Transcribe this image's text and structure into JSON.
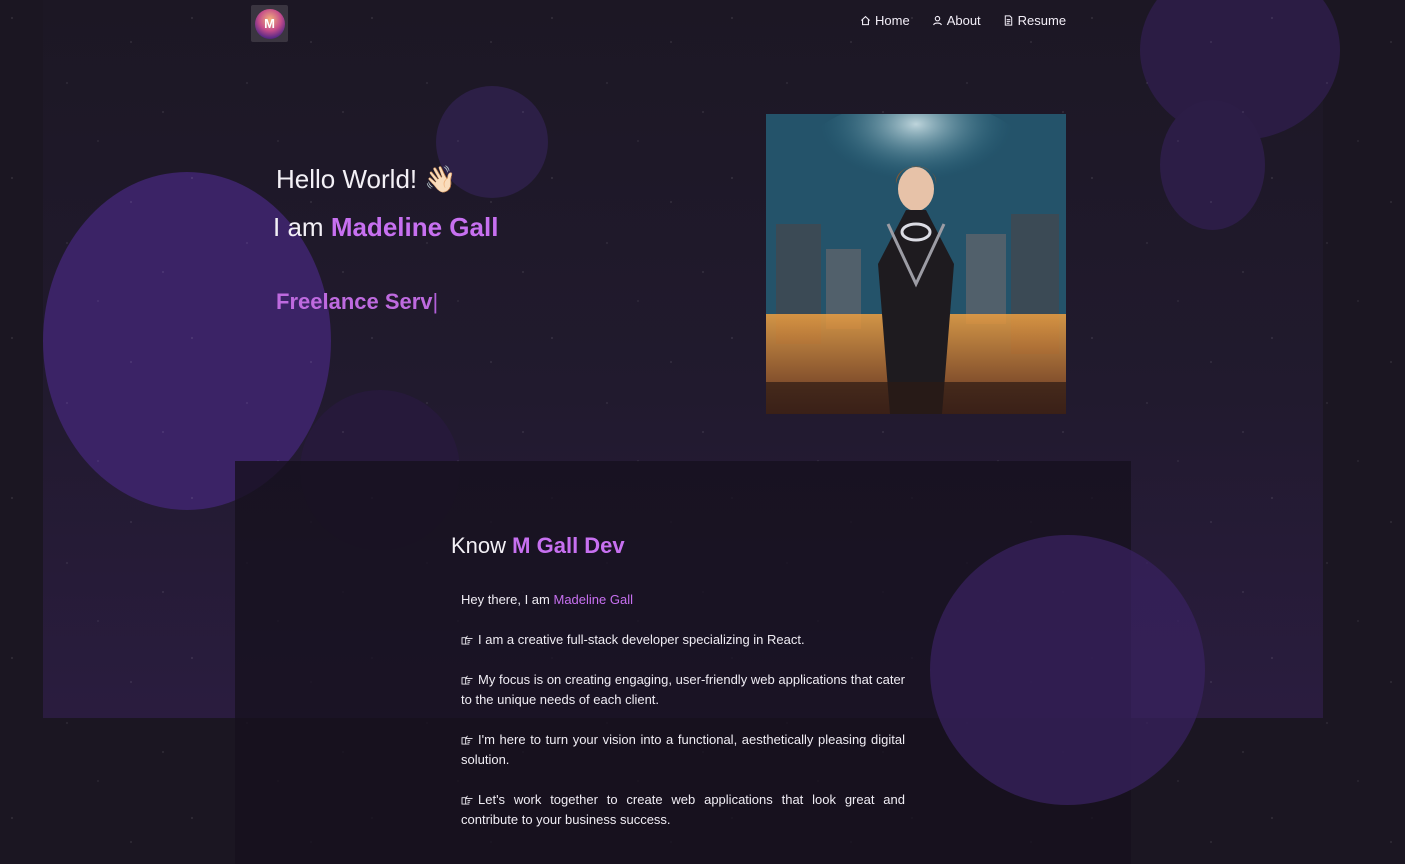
{
  "nav": {
    "items": [
      {
        "label": "Home",
        "icon": "home-icon"
      },
      {
        "label": "About",
        "icon": "user-icon"
      },
      {
        "label": "Resume",
        "icon": "document-icon"
      }
    ]
  },
  "hero": {
    "greeting": "Hello World!",
    "wave_emoji": "👋🏻",
    "intro_prefix": "I am",
    "name": "Madeline Gall",
    "typing_text": "Freelance Serv",
    "caret": "|"
  },
  "about": {
    "heading_prefix": "Know",
    "heading_highlight": "M Gall Dev",
    "intro_prefix": "Hey there, I am",
    "intro_name": "Madeline Gall",
    "bullets": [
      "I am a creative full-stack developer specializing in React.",
      "My focus is on creating engaging, user-friendly web applications that cater to the unique needs of each client.",
      "I'm here to turn your vision into a functional, aesthetically pleasing digital solution.",
      "Let's work together to create web applications that look great and contribute to your business success."
    ]
  },
  "colors": {
    "accent": "#c770f0",
    "background": "#1b1622",
    "blob": "#3a2363"
  }
}
